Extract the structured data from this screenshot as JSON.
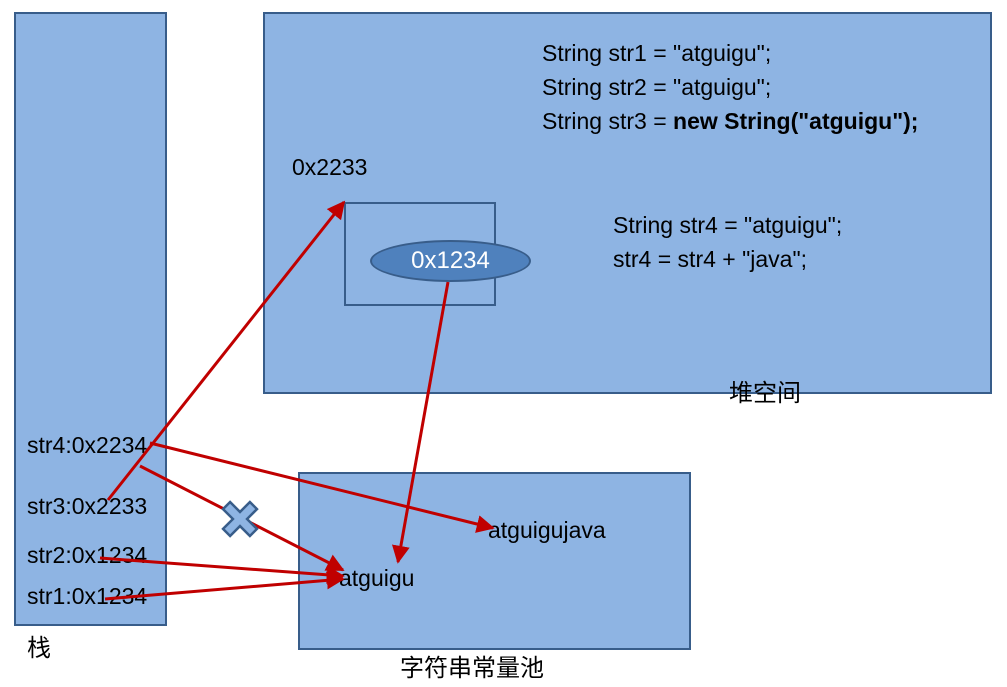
{
  "regions": {
    "stack_label": "栈",
    "heap_label": "堆空间",
    "pool_label": "字符串常量池"
  },
  "code": {
    "line1": "String str1 = \"atguigu\";",
    "line2": "String str2 = \"atguigu\";",
    "line3_prefix": "String str3 = ",
    "line3_bold": "new String(\"atguigu\");",
    "line4": "String str4 = \"atguigu\";",
    "line5": "str4 = str4 + \"java\";"
  },
  "heap": {
    "object_address": "0x2233",
    "inner_reference": "0x1234"
  },
  "stack": {
    "entries": [
      "str4:0x2234",
      "str3:0x2233",
      "str2:0x1234",
      "str1:0x1234"
    ]
  },
  "pool": {
    "literals": [
      "atguigu",
      "atguigujava"
    ]
  },
  "colors": {
    "region_fill": "#8eb4e3",
    "region_border": "#385d8a",
    "ellipse_fill": "#4f81bd",
    "arrow": "#c00000",
    "cross_fill": "#8eb4e3"
  },
  "icons": {
    "invalidated_reference": "cross-mark-icon"
  }
}
